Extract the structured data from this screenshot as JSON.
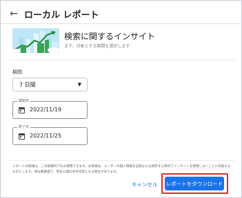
{
  "header": {
    "back_icon": "arrow-left-icon",
    "title": "ローカル レポート"
  },
  "insight": {
    "title": "検索に関するインサイト",
    "subtitle": "まず、対象とする期間を選択します"
  },
  "period": {
    "label": "期間",
    "selected": "7 日間"
  },
  "start_date": {
    "label": "開始日",
    "value": "2022/11/19"
  },
  "end_date": {
    "label": "終了日",
    "value": "2022/11/25"
  },
  "disclaimer": "レポートの情報は、この組織内でのみ使用できます。お客様は、ユーザーの個人情報を記録または保存する目的でインサイトを使用しないことに同意するものとします。律は概算値で、現在公開の条件次第となる場合があります。",
  "actions": {
    "cancel_label": "キャンセル",
    "download_label": "レポートをダウンロード"
  },
  "colors": {
    "accent": "#1a73e8",
    "highlight": "#d93025",
    "illustration_sky": "#bfe6f7",
    "illustration_green": "#1e8e3e"
  }
}
